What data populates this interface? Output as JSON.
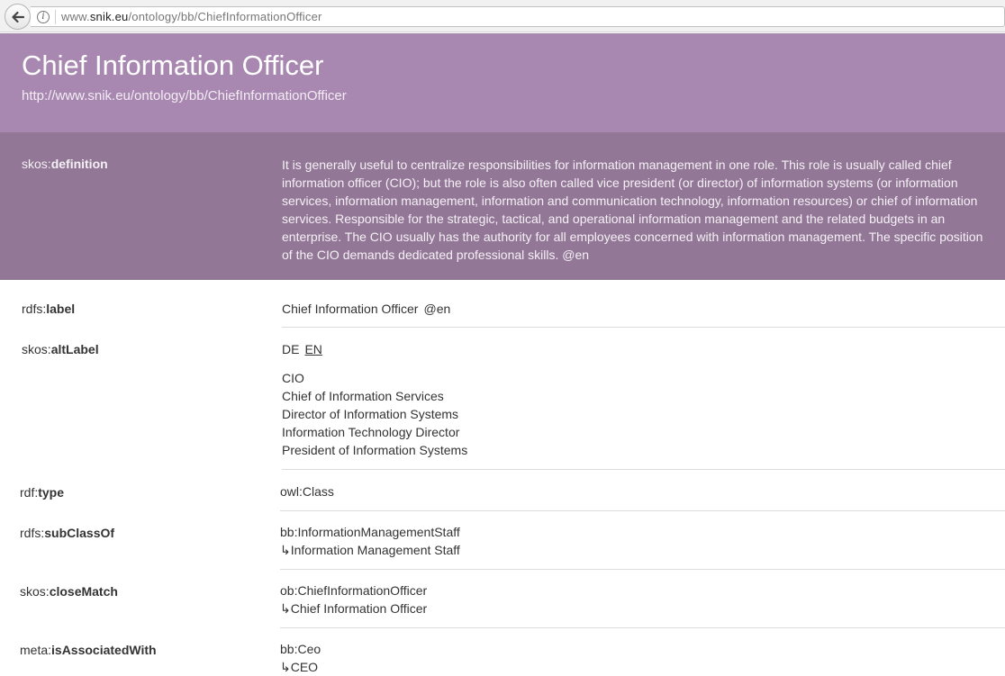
{
  "browser": {
    "url_prefix": "www.",
    "url_host": "snik.eu",
    "url_path": "/ontology/bb/ChiefInformationOfficer"
  },
  "header": {
    "title": "Chief Information Officer",
    "uri": "http://www.snik.eu/ontology/bb/ChiefInformationOfficer"
  },
  "definition": {
    "prefix": "skos:",
    "name": "definition",
    "text": "It is generally useful to centralize responsibilities for information management in one role. This role is usually called chief information officer (CIO); but the role is also often called vice president (or director) of information systems (or information services, information management, information and communication technology, information resources) or chief of information services. Responsible for the strategic, tactical, and operational information management and the related budgets in an enterprise. The CIO usually has the authority for all employees concerned with information management. The specific position of the CIO demands dedicated professional skills. @en"
  },
  "label": {
    "prefix": "rdfs:",
    "name": "label",
    "value": "Chief Information Officer",
    "lang": "@en"
  },
  "altLabel": {
    "prefix": "skos:",
    "name": "altLabel",
    "tabs": [
      "DE",
      "EN"
    ],
    "values": [
      "CIO",
      "Chief of Information Services",
      "Director of Information Systems",
      "Information Technology Director",
      "President of Information Systems"
    ]
  },
  "type": {
    "prefix": "rdf:",
    "name": "type",
    "value": "owl:Class"
  },
  "subClassOf": {
    "prefix": "rdfs:",
    "name": "subClassOf",
    "value": "bb:InformationManagementStaff",
    "label": "↳Information Management Staff"
  },
  "closeMatch": {
    "prefix": "skos:",
    "name": "closeMatch",
    "value": "ob:ChiefInformationOfficer",
    "label": "↳Chief Information Officer"
  },
  "isAssociatedWith": {
    "prefix": "meta:",
    "name": "isAssociatedWith",
    "value": "bb:Ceo",
    "label": "↳CEO"
  }
}
